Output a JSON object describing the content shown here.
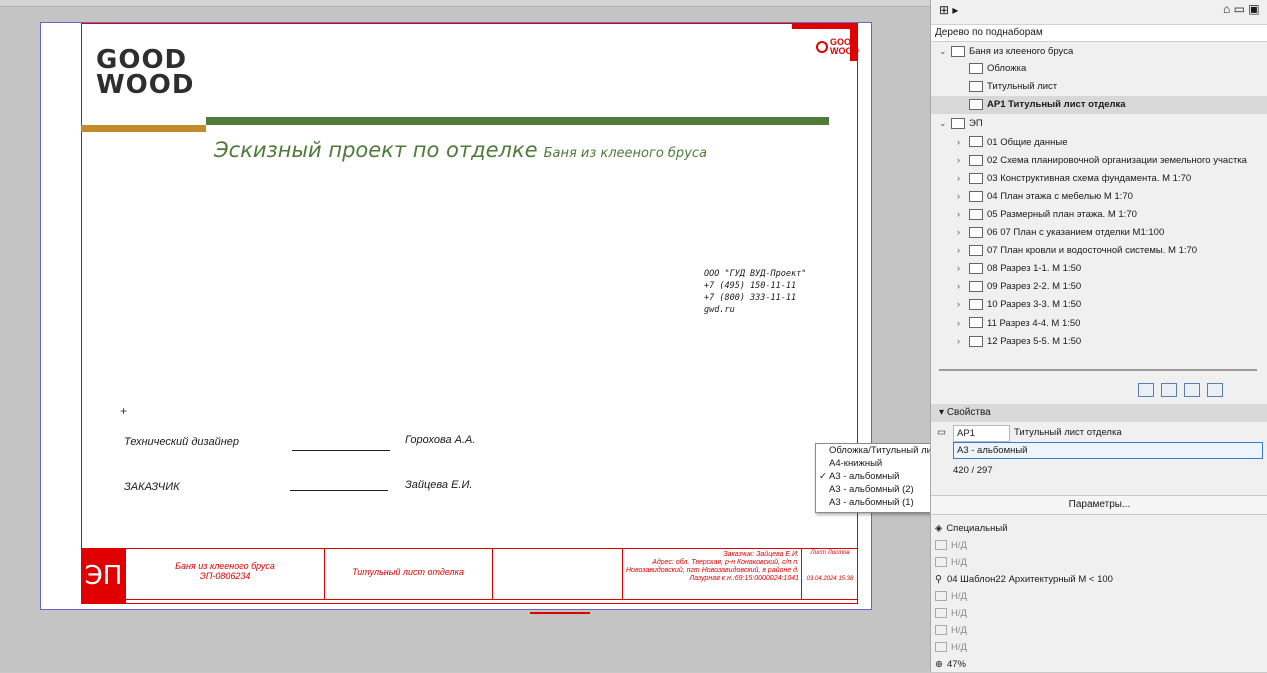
{
  "sheet": {
    "logo_top": "GOOD",
    "logo_bottom": "WOOD",
    "corner_logo_top": "GOOD",
    "corner_logo_bottom": "WOOD",
    "title": "Эскизный проект по отделке",
    "subtitle": "Баня из клееного бруса",
    "company": [
      "ООО \"ГУД ВУД-Проект\"",
      "+7 (495) 150-11-11",
      "+7 (800) 333-11-11",
      "gwd.ru"
    ],
    "signatures": [
      {
        "role": "Технический дизайнер",
        "name": "Горохова А.А."
      },
      {
        "role": "ЗАКАЗЧИК",
        "name": "Зайцева Е.И."
      }
    ],
    "titleblock": {
      "code_badge": "ЭП",
      "project": "Баня из клееного бруса",
      "project_code": "ЭП-0806234",
      "sheet_name": "Титульный лист отделка",
      "client": "Заказчик: Зайцева Е.И.",
      "address": "Адрес: обл. Тверская, р-н Конаковский, с/п п. Новозавидовский, пгт Новозавидовский, в районе д. Лазурная к.н.:69:15:0000024:1041",
      "col_sheet": "Лист",
      "col_sheets": "Листов",
      "date": "03.04.2024 15:38"
    }
  },
  "panel": {
    "tree_header": "Дерево по поднаборам",
    "tree": [
      {
        "label": "Баня из клееного бруса",
        "level": 0,
        "chev": "v"
      },
      {
        "label": "Обложка",
        "level": 1,
        "chev": ""
      },
      {
        "label": "Титульный лист",
        "level": 1,
        "chev": ""
      },
      {
        "label": "АР1 Титульный лист отделка",
        "level": 1,
        "chev": "",
        "selected": true
      },
      {
        "label": "ЭП",
        "level": 0,
        "chev": "v"
      },
      {
        "label": "01 Общие данные",
        "level": 1,
        "chev": ">"
      },
      {
        "label": "02 Схема планировочной организации земельного участка",
        "level": 1,
        "chev": ">"
      },
      {
        "label": "03 Конструктивная схема фундамента.  М 1:70",
        "level": 1,
        "chev": ">"
      },
      {
        "label": "04 План этажа с мебелью  М 1:70",
        "level": 1,
        "chev": ">"
      },
      {
        "label": "05 Размерный план этажа.  М 1:70",
        "level": 1,
        "chev": ">"
      },
      {
        "label": "06 07 План с указанием отделки М1:100",
        "level": 1,
        "chev": ">"
      },
      {
        "label": "07 План кровли и водосточной системы.  М 1:70",
        "level": 1,
        "chev": ">"
      },
      {
        "label": "08 Разрез 1-1.  М 1:50",
        "level": 1,
        "chev": ">"
      },
      {
        "label": "09 Разрез 2-2.  М 1:50",
        "level": 1,
        "chev": ">"
      },
      {
        "label": "10 Разрез 3-3.  М 1:50",
        "level": 1,
        "chev": ">"
      },
      {
        "label": "11 Разрез 4-4.  М 1:50",
        "level": 1,
        "chev": ">"
      },
      {
        "label": "12 Разрез 5-5.  М 1:50",
        "level": 1,
        "chev": ">"
      }
    ],
    "props_header": "Свойства",
    "prop_id": "АР1",
    "prop_name": "Титульный лист отделка",
    "prop_format": "A3 - альбомный",
    "prop_size": "420 / 297",
    "params_button": "Параметры...",
    "special_label": "Специальный",
    "na": "Н/Д",
    "template": "04 Шаблон22 Архитектурный М < 100",
    "zoom": "47%",
    "dropdown": [
      {
        "label": "Обложка/Титульный лист",
        "checked": false
      },
      {
        "label": "А4-книжный",
        "checked": false
      },
      {
        "label": "А3 - альбомный",
        "checked": true
      },
      {
        "label": "А3 - альбомный (2)",
        "checked": false
      },
      {
        "label": "А3 - альбомный (1)",
        "checked": false
      }
    ],
    "colors": {
      "accent_red": "#e10000",
      "green": "#4e7a3a",
      "gold": "#c38a2a"
    }
  }
}
